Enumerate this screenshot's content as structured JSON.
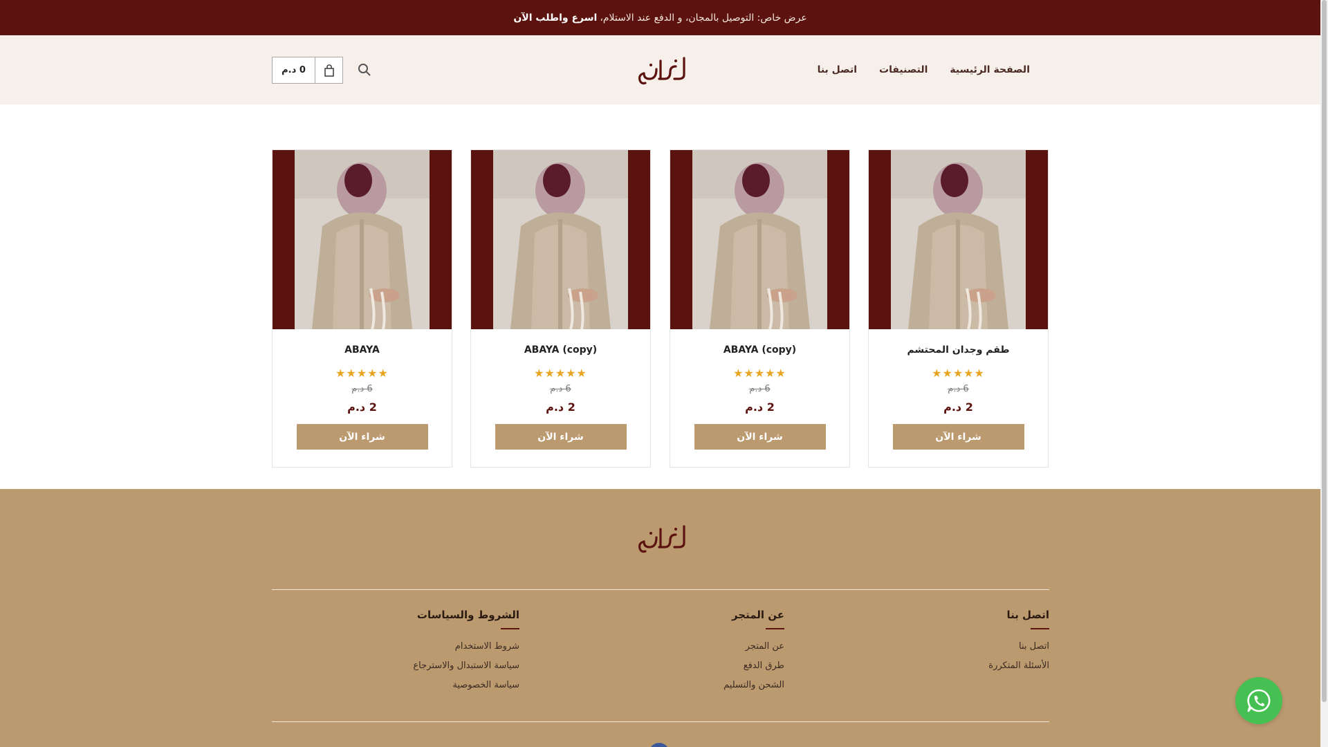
{
  "announcement": {
    "text": "عرض خاص: التوصيل بالمجان، و الدفع عند الاستلام،",
    "bold": "اسرع واطلب الآن"
  },
  "nav": {
    "home": "الصفحة الرئيسية",
    "categories": "التصنيفات",
    "contact": "اتصل بنا"
  },
  "logo_text": "وجدان",
  "cart": {
    "total": "0 د.م"
  },
  "products": [
    {
      "title": "طقم وجدان المحتشم",
      "stars": "★★★★★",
      "old_price": "6 د.م",
      "price": "2 د.م",
      "button": "شراء الآن"
    },
    {
      "title": "ABAYA (copy)",
      "stars": "★★★★★",
      "old_price": "6 د.م",
      "price": "2 د.م",
      "button": "شراء الآن"
    },
    {
      "title": "ABAYA (copy)",
      "stars": "★★★★★",
      "old_price": "6 د.م",
      "price": "2 د.م",
      "button": "شراء الآن"
    },
    {
      "title": "ABAYA",
      "stars": "★★★★★",
      "old_price": "6 د.م",
      "price": "2 د.م",
      "button": "شراء الآن"
    }
  ],
  "footer": {
    "contact": {
      "heading": "اتصل بنا",
      "links": [
        "اتصل بنا",
        "الأسئلة المتكررة"
      ]
    },
    "about": {
      "heading": "عن المتجر",
      "links": [
        "عن المتجر",
        "طرق الدفع",
        "الشحن والتسليم"
      ]
    },
    "policies": {
      "heading": "الشروط والسياسات",
      "links": [
        "شروط الاستخدام",
        "سياسة الاستبدال والاسترجاع",
        "سياسة الخصوصية"
      ]
    }
  },
  "colors": {
    "brand_dark": "#5c1310",
    "accent": "#bc9a70",
    "header_bg": "#f6efea",
    "star": "#e8a521",
    "whatsapp": "#46c053"
  },
  "icons": {
    "search": "search-icon",
    "cart": "cart-icon",
    "whatsapp": "whatsapp-icon"
  }
}
